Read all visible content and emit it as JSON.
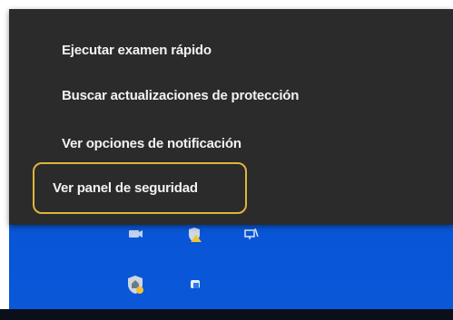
{
  "context_menu": {
    "items": [
      {
        "label": "Ejecutar examen rápido"
      },
      {
        "label": "Buscar actualizaciones de protección"
      },
      {
        "label": "Ver opciones de notificación"
      },
      {
        "label": "Ver panel de seguridad",
        "highlighted": true
      }
    ]
  },
  "tray": {
    "icons": [
      {
        "name": "meet-now-icon"
      },
      {
        "name": "warning-shield-icon"
      },
      {
        "name": "network-icon"
      },
      {
        "name": "security-shield-icon"
      },
      {
        "name": "app-square-icon"
      }
    ]
  },
  "colors": {
    "menu_background": "#2b2b2b",
    "menu_text": "#f2f2f2",
    "highlight_border": "#e0b43a",
    "desktop_blue": "#0756d6"
  }
}
